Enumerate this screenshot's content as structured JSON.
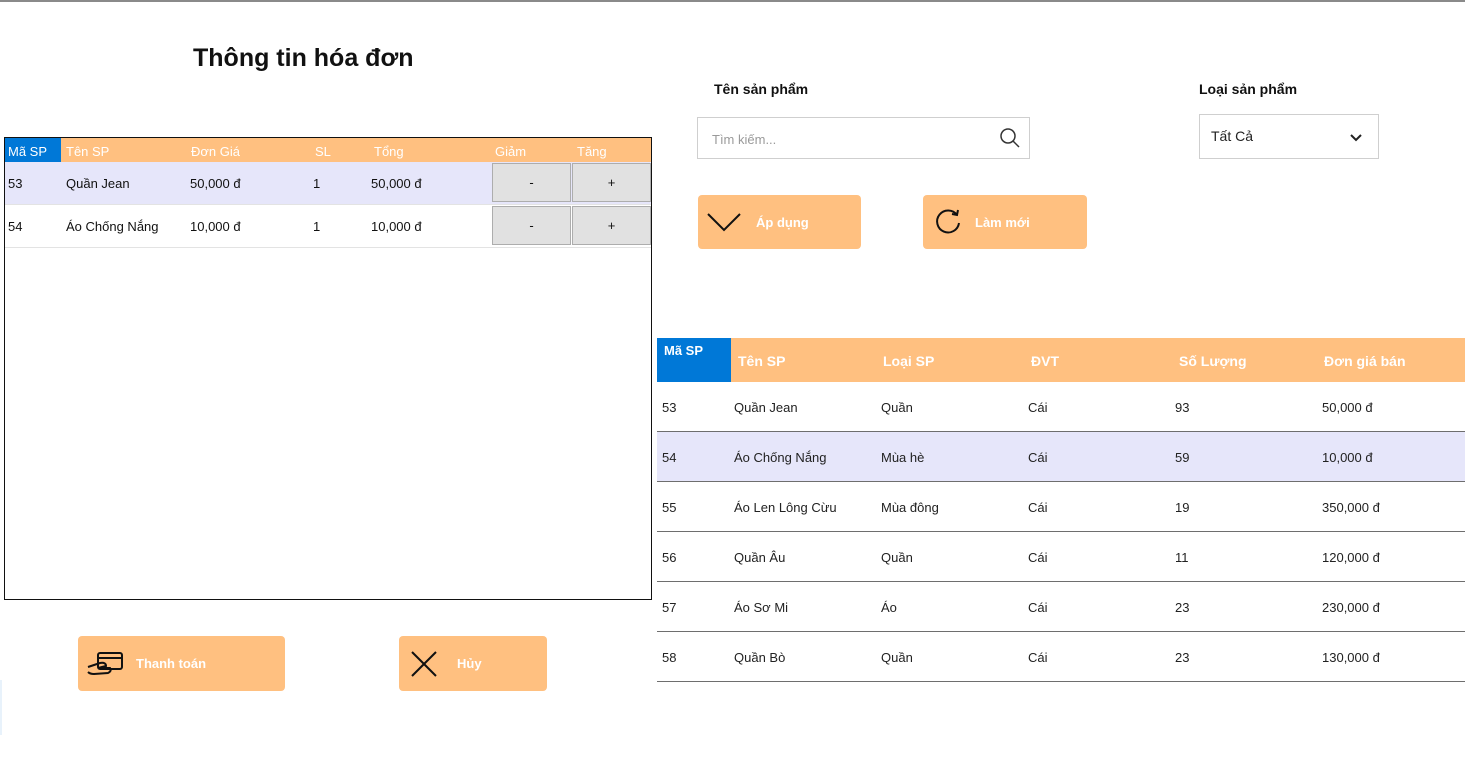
{
  "invoice": {
    "title": "Thông tin hóa đơn",
    "columns": [
      "Mã SP",
      "Tên SP",
      "Đơn Giá",
      "SL",
      "Tổng",
      "Giảm",
      "Tăng"
    ],
    "rows": [
      {
        "id": "53",
        "name": "Quần Jean",
        "price": "50,000 đ",
        "qty": "1",
        "total": "50,000 đ",
        "dec": "-",
        "inc": "+"
      },
      {
        "id": "54",
        "name": "Áo Chống Nắng",
        "price": "10,000 đ",
        "qty": "1",
        "total": "10,000 đ",
        "dec": "-",
        "inc": "+"
      }
    ],
    "pay_label": "Thanh toán",
    "cancel_label": "Hủy"
  },
  "filter": {
    "name_label": "Tên sản phẩm",
    "search_placeholder": "Tìm kiếm...",
    "category_label": "Loại sản phẩm",
    "category_value": "Tất Cả",
    "apply_label": "Áp dụng",
    "refresh_label": "Làm mới"
  },
  "products": {
    "columns": [
      "Mã SP",
      "Tên SP",
      "Loại SP",
      "ĐVT",
      "Số Lượng",
      "Đơn giá bán"
    ],
    "rows": [
      {
        "id": "53",
        "name": "Quần Jean",
        "type": "Quần",
        "unit": "Cái",
        "qty": "93",
        "price": "50,000 đ"
      },
      {
        "id": "54",
        "name": "Áo Chống Nắng",
        "type": "Mùa hè",
        "unit": "Cái",
        "qty": "59",
        "price": "10,000 đ"
      },
      {
        "id": "55",
        "name": "Áo Len Lông Cừu",
        "type": "Mùa đông",
        "unit": "Cái",
        "qty": "19",
        "price": "350,000 đ"
      },
      {
        "id": "56",
        "name": "Quần Âu",
        "type": "Quần",
        "unit": "Cái",
        "qty": "11",
        "price": "120,000 đ"
      },
      {
        "id": "57",
        "name": "Áo Sơ Mi",
        "type": "Áo",
        "unit": "Cái",
        "qty": "23",
        "price": "230,000 đ"
      },
      {
        "id": "58",
        "name": "Quần Bò",
        "type": "Quần",
        "unit": "Cái",
        "qty": "23",
        "price": "130,000 đ"
      }
    ]
  },
  "colors": {
    "header_orange": "#ffc080",
    "selected_header_blue": "#0078d7",
    "selected_row": "#e6e6fa"
  }
}
